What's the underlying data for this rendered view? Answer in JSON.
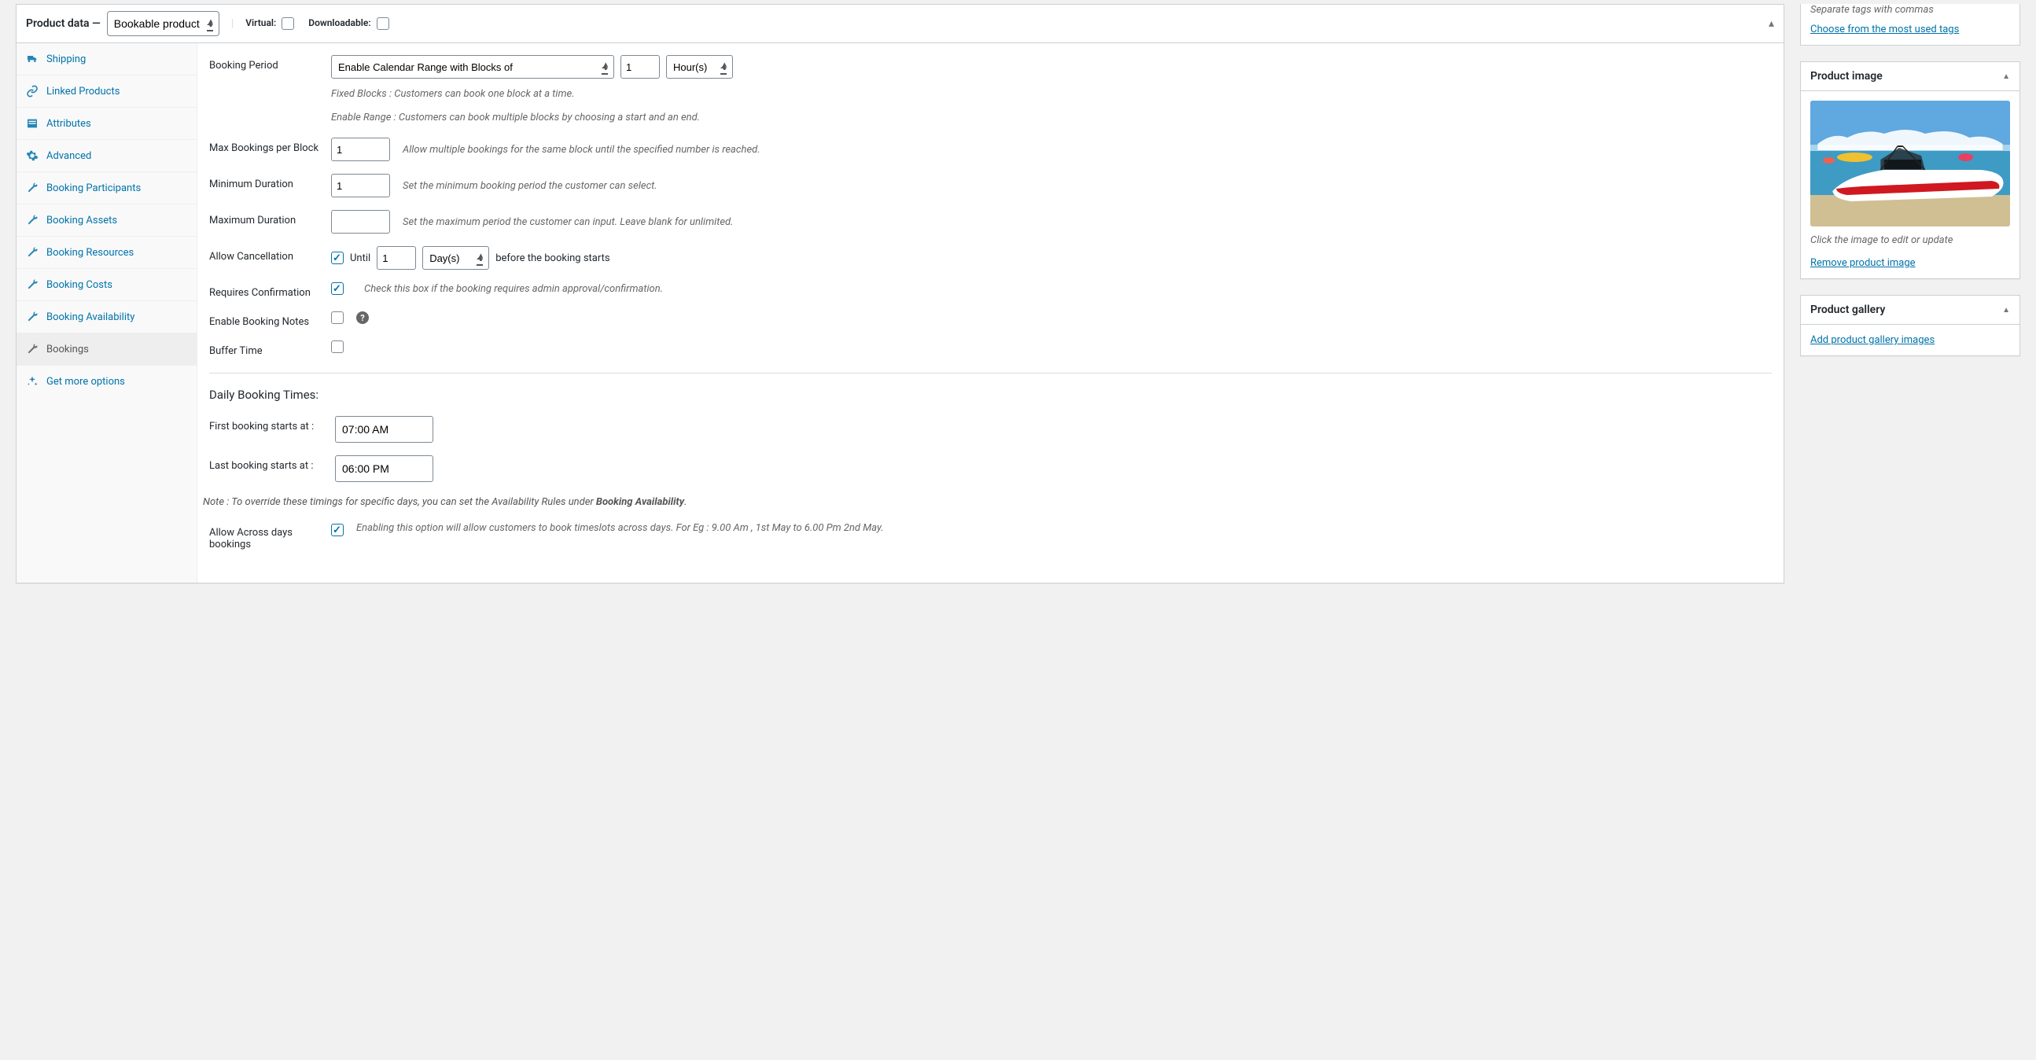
{
  "header": {
    "title_prefix": "Product data —",
    "product_type": "Bookable product",
    "virtual_label": "Virtual:",
    "downloadable_label": "Downloadable:"
  },
  "tabs": [
    {
      "id": "shipping",
      "label": "Shipping"
    },
    {
      "id": "linked",
      "label": "Linked Products"
    },
    {
      "id": "attributes",
      "label": "Attributes"
    },
    {
      "id": "advanced",
      "label": "Advanced"
    },
    {
      "id": "participants",
      "label": "Booking Participants"
    },
    {
      "id": "assets",
      "label": "Booking Assets"
    },
    {
      "id": "resources",
      "label": "Booking Resources"
    },
    {
      "id": "costs",
      "label": "Booking Costs"
    },
    {
      "id": "availability",
      "label": "Booking Availability"
    },
    {
      "id": "bookings",
      "label": "Bookings"
    },
    {
      "id": "more",
      "label": "Get more options"
    }
  ],
  "booking": {
    "booking_period_label": "Booking Period",
    "booking_period_mode": "Enable Calendar Range with Blocks of",
    "booking_period_qty": "1",
    "booking_period_unit": "Hour(s)",
    "booking_period_help1": "Fixed Blocks : Customers can book one block at a time.",
    "booking_period_help2": "Enable Range : Customers can book multiple blocks by choosing a start and an end.",
    "max_bookings_label": "Max Bookings per Block",
    "max_bookings_value": "1",
    "max_bookings_help": "Allow multiple bookings for the same block until the specified number is reached.",
    "min_duration_label": "Minimum Duration",
    "min_duration_value": "1",
    "min_duration_help": "Set the minimum booking period the customer can select.",
    "max_duration_label": "Maximum Duration",
    "max_duration_value": "",
    "max_duration_help": "Set the maximum period the customer can input. Leave blank for unlimited.",
    "allow_cancel_label": "Allow Cancellation",
    "allow_cancel_until": "Until",
    "allow_cancel_value": "1",
    "allow_cancel_unit": "Day(s)",
    "allow_cancel_suffix": "before the booking starts",
    "requires_confirm_label": "Requires Confirmation",
    "requires_confirm_help": "Check this box if the booking requires admin approval/confirmation.",
    "enable_notes_label": "Enable Booking Notes",
    "buffer_time_label": "Buffer Time",
    "daily_heading": "Daily Booking Times:",
    "first_booking_label": "First booking starts at :",
    "first_booking_value": "07:00 AM",
    "last_booking_label": "Last booking starts at :",
    "last_booking_value": "06:00 PM",
    "note_prefix": "Note : To override these timings for specific days, you can set the Availability Rules under ",
    "note_bold": "Booking Availability",
    "note_suffix": ".",
    "allow_across_label": "Allow Across days bookings",
    "allow_across_help": "Enabling this option will allow customers to book timeslots across days. For Eg : 9.00 Am , 1st May to 6.00 Pm 2nd May."
  },
  "sidebar": {
    "tags_hint": "Separate tags with commas",
    "tags_link": "Choose from the most used tags",
    "product_image_title": "Product image",
    "image_hint": "Click the image to edit or update",
    "remove_image": "Remove product image",
    "gallery_title": "Product gallery",
    "gallery_link": "Add product gallery images"
  }
}
